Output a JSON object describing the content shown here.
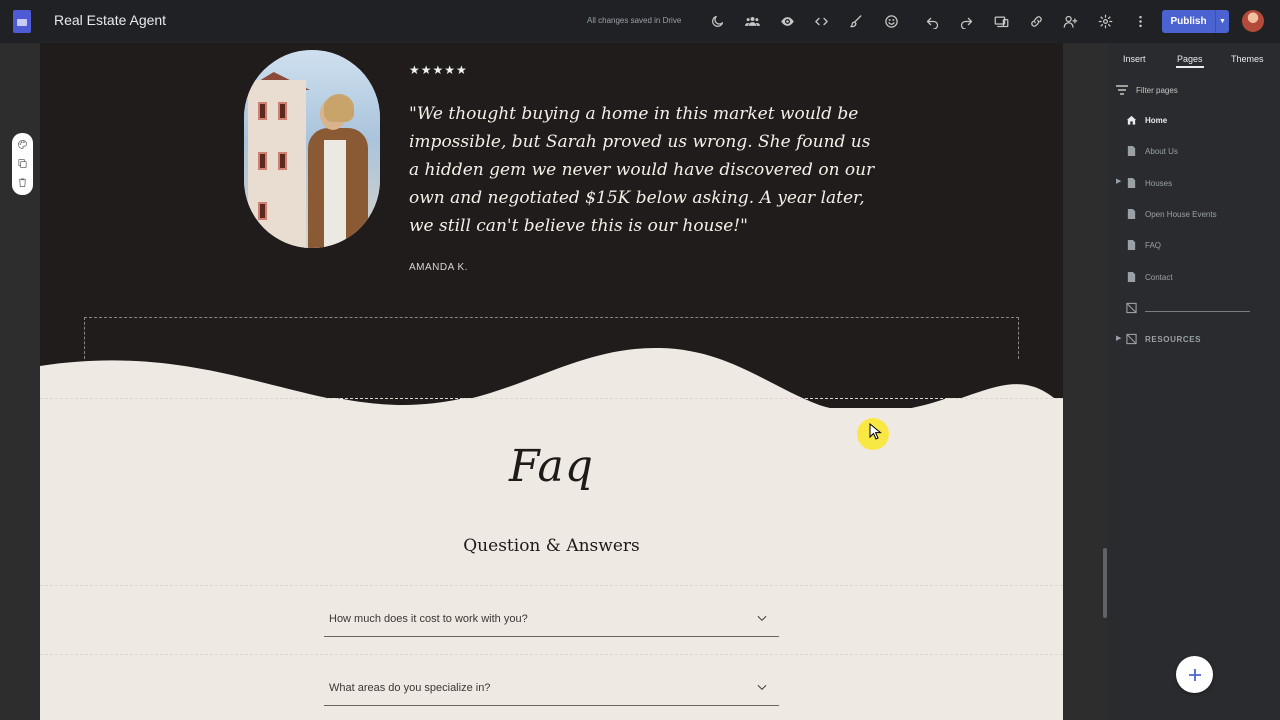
{
  "app": {
    "site_title": "Real Estate Agent",
    "save_status": "All changes saved in Drive",
    "publish_label": "Publish",
    "publish_arrow": "▼"
  },
  "toolbar": {
    "icons": [
      "dark-mode-icon",
      "share-people-icon",
      "preview-icon",
      "embed-code-icon",
      "theme-brush-icon",
      "emoji-icon",
      "undo-icon",
      "redo-icon",
      "device-preview-icon",
      "link-icon",
      "add-person-icon",
      "settings-gear-icon",
      "more-options-icon"
    ]
  },
  "testimonial": {
    "rating": "★★★★★",
    "quote": "\"We thought buying a home in this market would be impossible, but Sarah proved us wrong. She found us a hidden gem we never would have discovered on our own and negotiated $15K below asking. A year later, we still can't believe this is our house!\"",
    "author": "AMANDA K."
  },
  "faq": {
    "script_title": "Faq",
    "heading": "Question & Answers",
    "items": [
      {
        "question": "How much does it cost to work with you?"
      },
      {
        "question": "What areas do you specialize in?"
      }
    ]
  },
  "panel": {
    "tabs": [
      "Insert",
      "Pages",
      "Themes"
    ],
    "active_tab": "Pages",
    "filter_label": "Filter pages",
    "pages": [
      {
        "label": "Home",
        "icon": "home-icon",
        "active": true
      },
      {
        "label": "About Us",
        "icon": "page-icon",
        "active": false
      },
      {
        "label": "Houses",
        "icon": "page-icon",
        "active": false,
        "expandable": true
      },
      {
        "label": "Open House Events",
        "icon": "page-icon",
        "active": false
      },
      {
        "label": "FAQ",
        "icon": "page-icon",
        "active": false
      },
      {
        "label": "Contact",
        "icon": "page-icon",
        "active": false
      }
    ],
    "resources_label": "RESOURCES",
    "expander_glyph": "▶"
  },
  "colors": {
    "accent": "#4b63d1",
    "dark_section": "#1f1c1b",
    "light_section": "#efe9e4",
    "panel_bg": "#2a2b2e"
  }
}
